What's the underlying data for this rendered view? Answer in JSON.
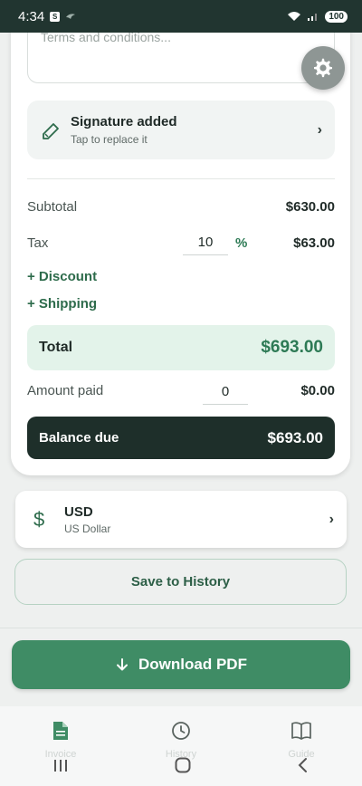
{
  "status_bar": {
    "time": "4:34",
    "battery": "100"
  },
  "terms": {
    "placeholder": "Terms and conditions..."
  },
  "signature": {
    "title": "Signature added",
    "subtitle": "Tap to replace it",
    "chevron": "›"
  },
  "totals": {
    "subtotal_label": "Subtotal",
    "subtotal_value": "$630.00",
    "tax_label": "Tax",
    "tax_rate": "10",
    "tax_unit": "%",
    "tax_value": "$63.00",
    "discount_link": "+ Discount",
    "shipping_link": "+ Shipping",
    "total_label": "Total",
    "total_value": "$693.00",
    "amount_paid_label": "Amount paid",
    "amount_paid_input": "0",
    "amount_paid_value": "$0.00",
    "balance_label": "Balance due",
    "balance_value": "$693.00"
  },
  "currency": {
    "symbol": "$",
    "code": "USD",
    "name": "US Dollar",
    "chevron": "›"
  },
  "actions": {
    "save_label": "Save to History",
    "download_label": "Download PDF"
  },
  "bottom_nav": {
    "items": [
      {
        "label": "Invoice",
        "icon": "document-icon"
      },
      {
        "label": "History",
        "icon": "clock-icon"
      },
      {
        "label": "Guide",
        "icon": "book-icon"
      }
    ]
  },
  "colors": {
    "accent": "#3f8c65",
    "dark": "#1e2f2a",
    "total_bg": "#e3f3ea"
  }
}
